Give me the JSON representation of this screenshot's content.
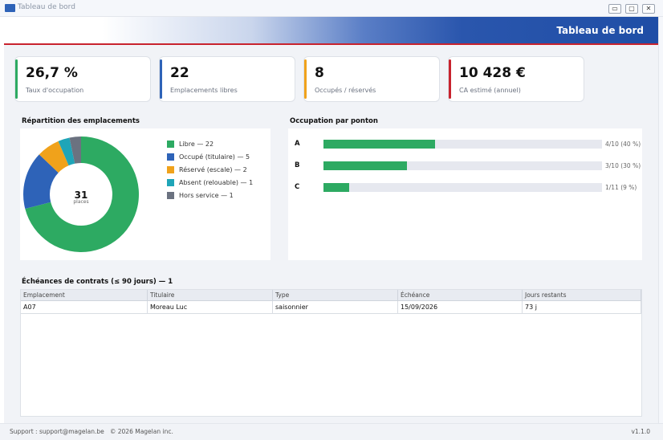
{
  "window": {
    "title": "Tableau de bord",
    "minimize": "▭",
    "maximize": "▢",
    "close": "✕"
  },
  "banner": {
    "title": "Tableau de bord"
  },
  "kpis": [
    {
      "value": "26,7 %",
      "label": "Taux d'occupation",
      "color": "#2daa62"
    },
    {
      "value": "22",
      "label": "Emplacements libres",
      "color": "#2e63b8"
    },
    {
      "value": "8",
      "label": "Occupés / réservés",
      "color": "#f0a21b"
    },
    {
      "value": "10 428 €",
      "label": "CA estimé (annuel)",
      "color": "#c8232e"
    }
  ],
  "repartition": {
    "title": "Répartition des emplacements",
    "total": "31",
    "total_label": "places",
    "legend": [
      {
        "label": "Libre — 22",
        "color": "#2daa62"
      },
      {
        "label": "Occupé (titulaire) — 5",
        "color": "#2e63b8"
      },
      {
        "label": "Réservé (escale) — 2",
        "color": "#f0a21b"
      },
      {
        "label": "Absent (relouable) — 1",
        "color": "#1fa5b8"
      },
      {
        "label": "Hors service — 1",
        "color": "#6b7280"
      }
    ]
  },
  "chart_data": {
    "type": "pie",
    "categories": [
      "Libre",
      "Occupé (titulaire)",
      "Réservé (escale)",
      "Absent (relouable)",
      "Hors service"
    ],
    "values": [
      22,
      5,
      2,
      1,
      1
    ],
    "colors": [
      "#2daa62",
      "#2e63b8",
      "#f0a21b",
      "#1fa5b8",
      "#6b7280"
    ],
    "title": "Répartition des emplacements"
  },
  "occupation": {
    "title": "Occupation par ponton",
    "rows": [
      {
        "label": "A",
        "fraction": 0.4,
        "value": "4/10  (40 %)"
      },
      {
        "label": "B",
        "fraction": 0.3,
        "value": "3/10  (30 %)"
      },
      {
        "label": "C",
        "fraction": 0.0909,
        "value": "1/11  (9 %)"
      }
    ]
  },
  "contracts": {
    "title": "Échéances de contrats (≤ 90 jours) — 1",
    "columns": [
      "Emplacement",
      "Titulaire",
      "Type",
      "Échéance",
      "Jours restants"
    ],
    "rows": [
      [
        "A07",
        "Moreau Luc",
        "saisonnier",
        "15/09/2026",
        "73 j"
      ]
    ]
  },
  "status": {
    "support": "Support : support@magelan.be",
    "copyright": "© 2026 Magelan inc.",
    "version": "v1.1.0"
  }
}
